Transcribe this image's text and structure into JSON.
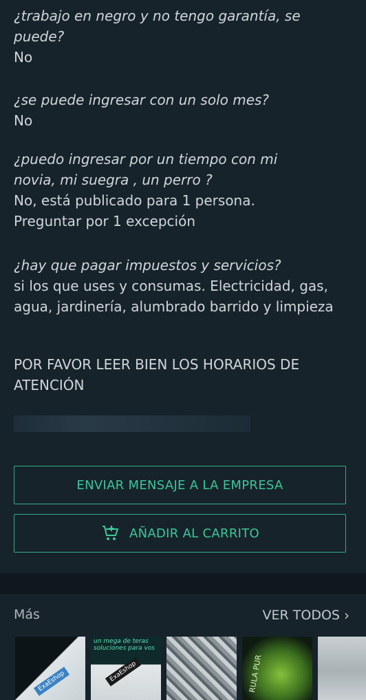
{
  "faq": [
    {
      "question": "¿trabajo en negro y no tengo garantía, se puede?",
      "answer": "No"
    },
    {
      "question": "¿se puede ingresar con un solo mes?",
      "answer": "No"
    },
    {
      "question": "¿puedo ingresar por un tiempo con mi novia, mi suegra , un perro ?",
      "answer": "No, está publicado para 1 persona. Preguntar por 1 excepción"
    },
    {
      "question": "¿hay que pagar impuestos y servicios?",
      "answer": "si los que uses y consumas. Electricidad, gas, agua, jardinería, alumbrado barrido y limpieza"
    }
  ],
  "notice": "POR FAVOR LEER BIEN LOS HORARIOS DE ATENCIÓN",
  "buttons": {
    "message": "ENVIAR MENSAJE A LA EMPRESA",
    "cart": "AÑADIR AL CARRITO"
  },
  "more": {
    "title": "Más",
    "see_all": "VER TODOS",
    "thumbnails": [
      {
        "name": "product-thumb-1",
        "badge": "ExaEshop"
      },
      {
        "name": "product-thumb-2",
        "caption": "un mega de teras soluciones para vos",
        "badge": "ExaEshop"
      },
      {
        "name": "product-thumb-3"
      },
      {
        "name": "product-thumb-4",
        "caption": "RULA PUR"
      },
      {
        "name": "product-thumb-5"
      }
    ]
  },
  "colors": {
    "accent": "#2fae8a",
    "background": "#17232b"
  }
}
